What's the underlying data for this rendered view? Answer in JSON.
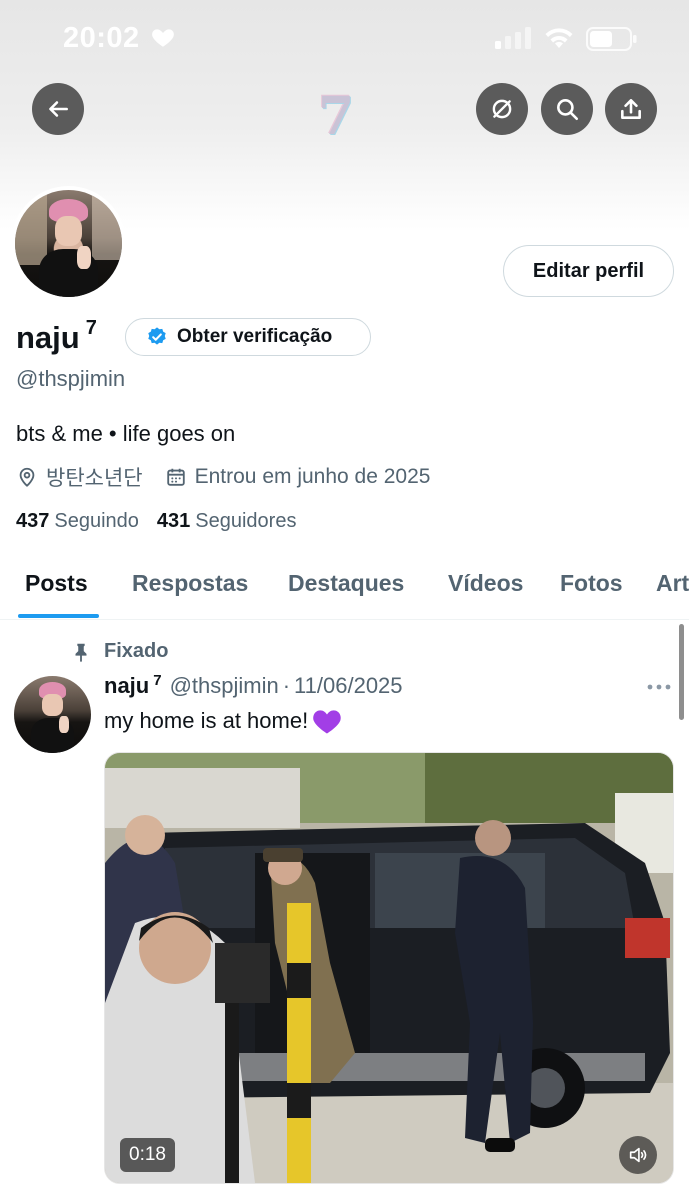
{
  "status_bar": {
    "time": "20:02"
  },
  "header": {
    "emblem": "7"
  },
  "profile": {
    "display_name": "naju",
    "name_badge": "7",
    "edit_profile_label": "Editar perfil",
    "verify_label": "Obter verificação",
    "handle": "@thspjimin",
    "bio": "bts & me • life goes on",
    "location": "방탄소년단",
    "joined": "Entrou em junho de 2025",
    "following_count": "437",
    "following_label": "Seguindo",
    "followers_count": "431",
    "followers_label": "Seguidores"
  },
  "tabs": [
    "Posts",
    "Respostas",
    "Destaques",
    "Vídeos",
    "Fotos",
    "Art"
  ],
  "post": {
    "pinned_label": "Fixado",
    "name": "naju",
    "name_badge": "7",
    "handle": "@thspjimin",
    "separator": "·",
    "date": "11/06/2025",
    "text": "my home is at home!",
    "video_duration": "0:18"
  },
  "colors": {
    "accent": "#1d9bf0",
    "secondary_text": "#536471",
    "emoji_heart": "#a23ee6"
  }
}
